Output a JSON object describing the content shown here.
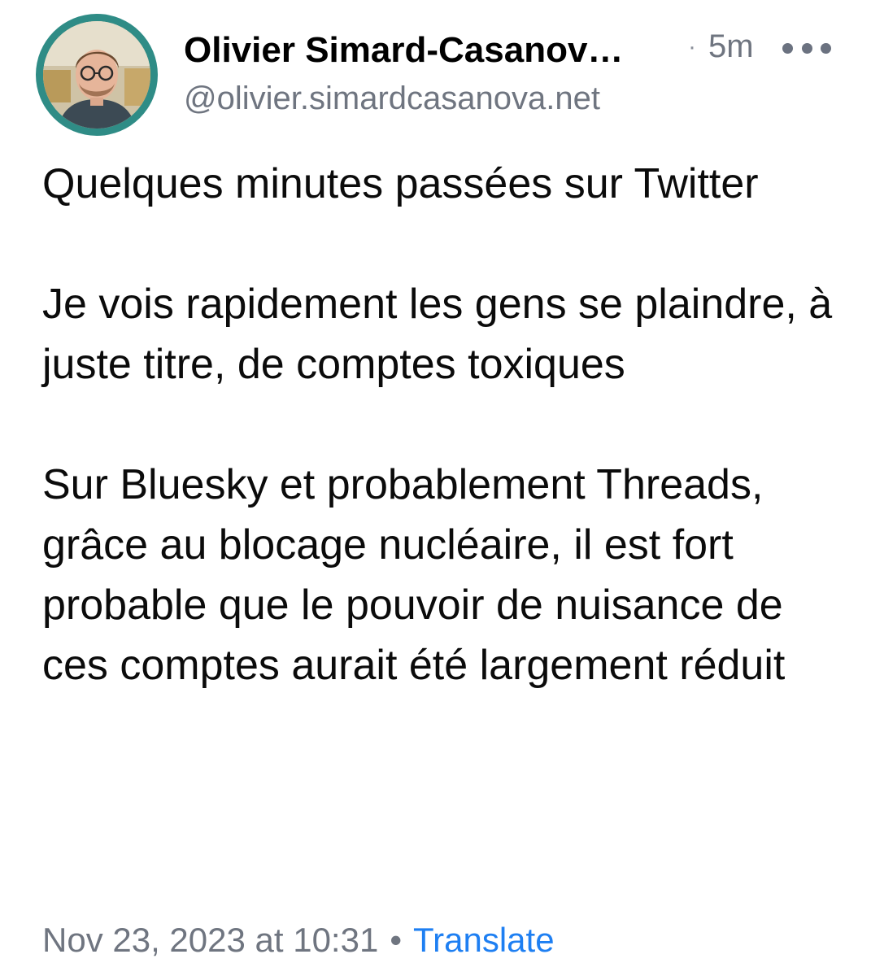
{
  "post": {
    "author": {
      "display_name": "Olivier Simard-Casanov…",
      "handle": "@olivier.simardcasanova.net",
      "avatar_icon": "profile-photo"
    },
    "time_separator": "·",
    "time_ago": "5m",
    "more_icon": "ellipsis-icon",
    "paragraphs": [
      "Quelques minutes passées sur Twitter",
      "Je vois rapidement les gens se plaindre, à juste titre, de comptes toxiques",
      "Sur Bluesky et probablement Threads, grâce au blocage nucléaire, il est fort probable que le pouvoir de nuisance de ces comptes aurait été largement réduit"
    ],
    "timestamp": "Nov 23, 2023 at 10:31",
    "footer_separator": "•",
    "translate_label": "Translate"
  },
  "colors": {
    "avatar_ring": "#2f8c86",
    "secondary_text": "#6f7580",
    "link": "#1e7ff2"
  }
}
